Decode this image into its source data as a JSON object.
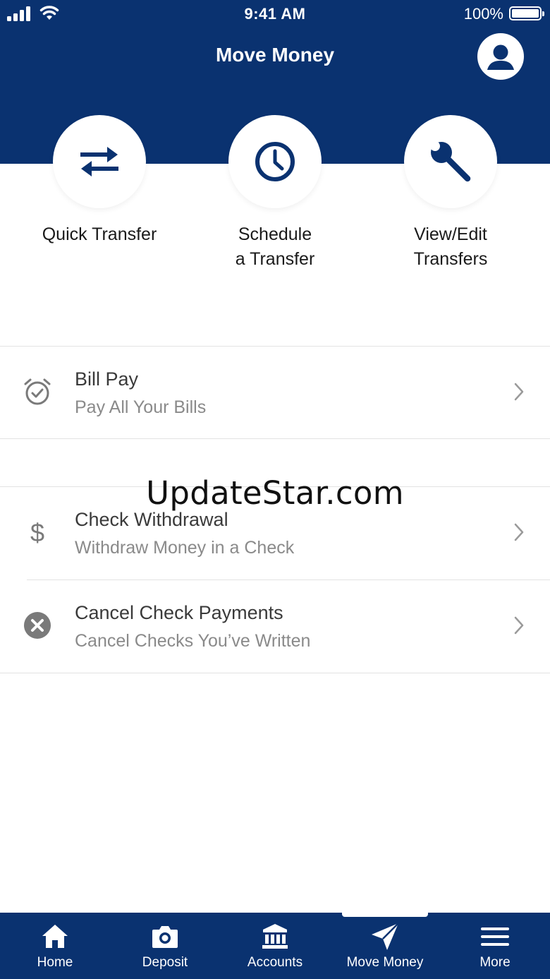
{
  "status_bar": {
    "time": "9:41 AM",
    "battery": "100%"
  },
  "header": {
    "title": "Move Money"
  },
  "quick_actions": [
    {
      "label_lines": [
        "Quick Transfer"
      ],
      "icon": "transfer-arrows-icon"
    },
    {
      "label_lines": [
        "Schedule",
        "a Transfer"
      ],
      "icon": "clock-icon"
    },
    {
      "label_lines": [
        "View/Edit",
        "Transfers"
      ],
      "icon": "wrench-icon"
    }
  ],
  "list": [
    {
      "title": "Bill Pay",
      "subtitle": "Pay All Your Bills",
      "icon": "alarm-check-icon"
    },
    {
      "title": "Check Withdrawal",
      "subtitle": "Withdraw Money in a Check",
      "icon": "dollar-icon"
    },
    {
      "title": "Cancel Check Payments",
      "subtitle": "Cancel Checks You’ve Written",
      "icon": "cancel-circle-icon"
    }
  ],
  "watermark": "UpdateStar.com",
  "tabs": [
    {
      "label": "Home",
      "icon": "home-icon"
    },
    {
      "label": "Deposit",
      "icon": "camera-icon"
    },
    {
      "label": "Accounts",
      "icon": "bank-icon"
    },
    {
      "label": "Move Money",
      "icon": "send-icon",
      "active": true
    },
    {
      "label": "More",
      "icon": "menu-icon"
    }
  ],
  "colors": {
    "brand_navy": "#0a3270",
    "icon_grey": "#7a7a7a",
    "white": "#ffffff"
  }
}
